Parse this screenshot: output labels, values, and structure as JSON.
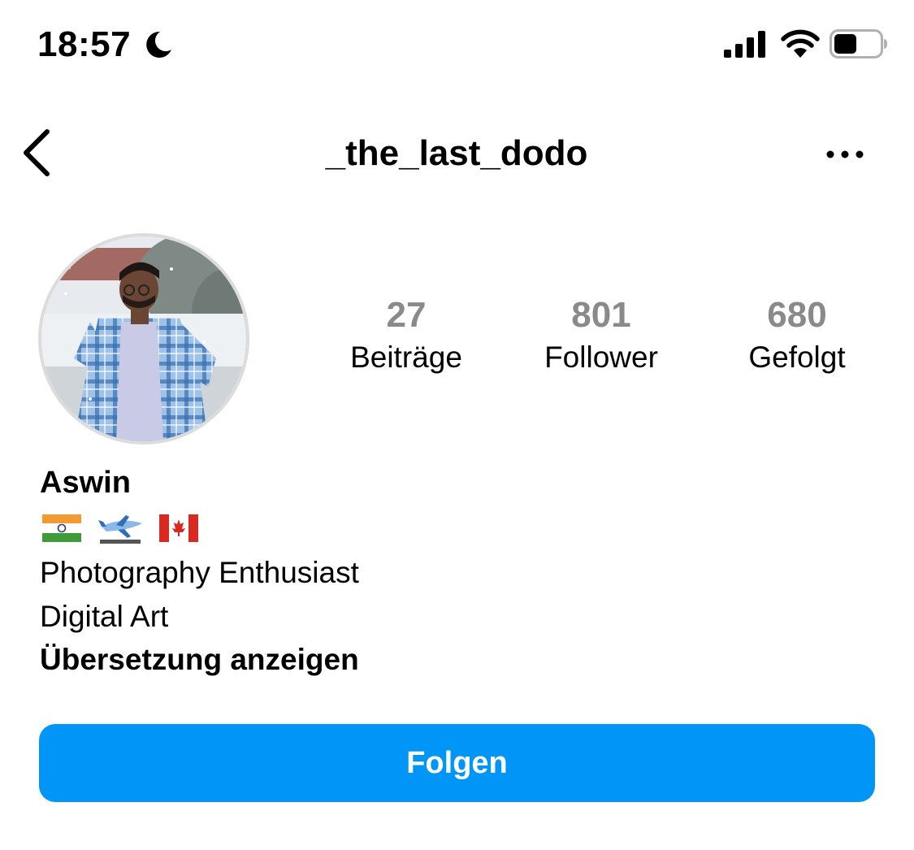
{
  "status_bar": {
    "time": "18:57",
    "icons": [
      "moon-icon",
      "signal-icon",
      "wifi-icon",
      "battery-icon"
    ]
  },
  "header": {
    "username": "_the_last_dodo",
    "back_icon": "chevron-left-icon",
    "more_icon": "more-horizontal-icon"
  },
  "profile": {
    "stats": [
      {
        "value": "27",
        "label": "Beiträge"
      },
      {
        "value": "801",
        "label": "Follower"
      },
      {
        "value": "680",
        "label": "Gefolgt"
      }
    ],
    "display_name": "Aswin",
    "emojis": [
      "india-flag-emoji",
      "airplane-emoji",
      "canada-flag-emoji"
    ],
    "bio_lines": [
      "Photography Enthusiast",
      "Digital Art"
    ],
    "translate_link": "Übersetzung anzeigen"
  },
  "actions": {
    "follow_label": "Folgen"
  },
  "colors": {
    "accent": "#0095f6",
    "stat_value": "#8a8a8a",
    "background": "#ffffff"
  }
}
